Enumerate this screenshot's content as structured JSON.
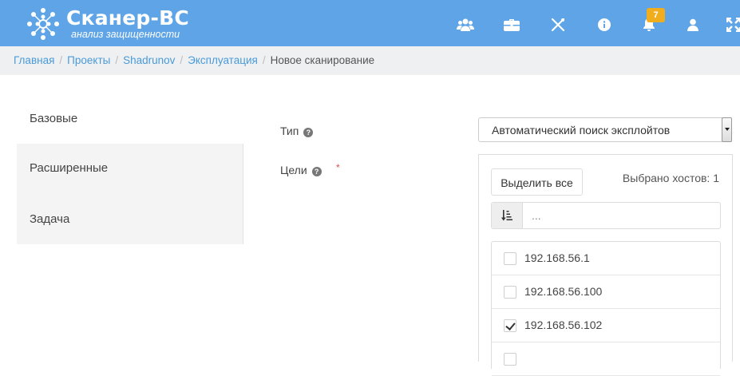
{
  "header": {
    "brand_title": "Сканер-ВС",
    "brand_subtitle": "анализ защищенности",
    "notification_count": "7",
    "icons": [
      "users-icon",
      "briefcase-icon",
      "tools-icon",
      "info-icon",
      "bell-icon",
      "user-icon",
      "expand-icon"
    ],
    "bg_color": "#5ea4e6",
    "badge_color": "#f0ad1e"
  },
  "breadcrumb": {
    "items": [
      "Главная",
      "Проекты",
      "Shadrunov",
      "Эксплуатация"
    ],
    "current": "Новое сканирование"
  },
  "tabs": [
    "Базовые",
    "Расширенные",
    "Задача"
  ],
  "form": {
    "type_label": "Тип",
    "type_value": "Автоматический поиск эксплойтов",
    "targets_label": "Цели",
    "required_mark": "*",
    "select_all_label": "Выделить все",
    "selected_count": "Выбрано хостов: 1",
    "filter_placeholder": "...",
    "hosts": [
      {
        "ip": "192.168.56.1",
        "checked": false
      },
      {
        "ip": "192.168.56.100",
        "checked": false
      },
      {
        "ip": "192.168.56.102",
        "checked": true
      }
    ]
  }
}
